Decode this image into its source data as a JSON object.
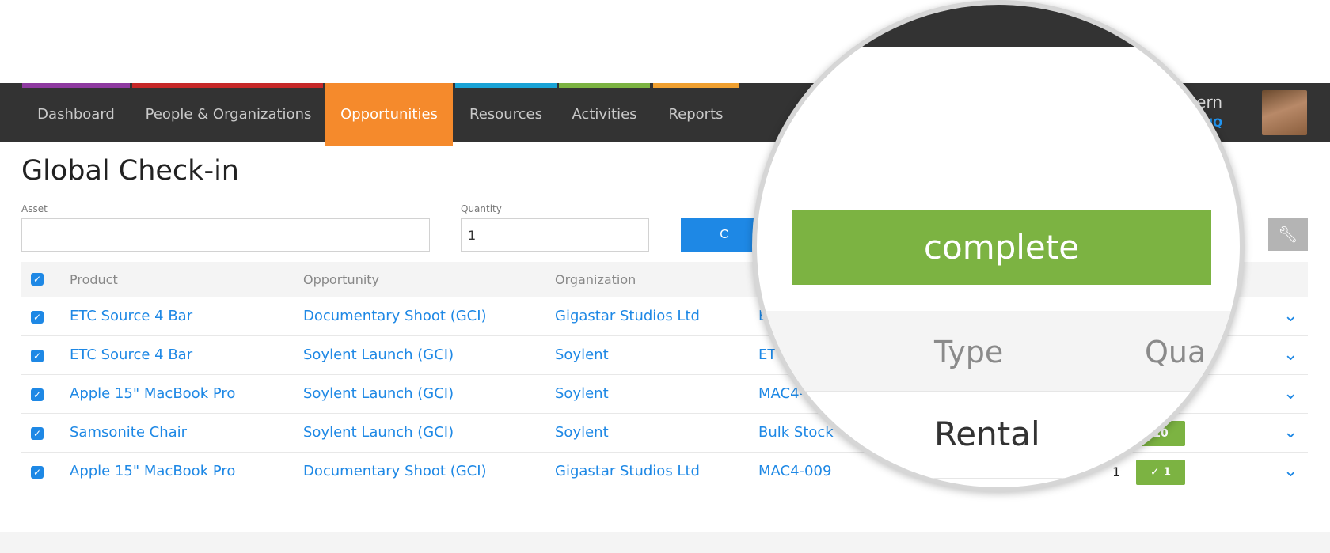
{
  "nav": {
    "items": [
      {
        "label": "Dashboard",
        "stripe": "#333333"
      },
      {
        "label": "People & Organizations",
        "stripe": "#c62828"
      },
      {
        "label": "Opportunities",
        "stripe": "#f58a2c",
        "active": true
      },
      {
        "label": "Resources",
        "stripe": "#1aa3d6"
      },
      {
        "label": "Activities",
        "stripe": "#7cb342"
      },
      {
        "label": "Reports",
        "stripe": "#f0a030"
      }
    ],
    "first_stripe": "#8e3aa0",
    "user_name": "Govern",
    "user_location": "AV: HQ"
  },
  "page": {
    "title": "Global Check-in",
    "asset_label": "Asset",
    "asset_value": "",
    "quantity_label": "Quantity",
    "quantity_value": "1",
    "checkin_button": "C",
    "settings_icon": "wrench-icon"
  },
  "table": {
    "headers": [
      "Product",
      "Opportunity",
      "Organization"
    ],
    "rows": [
      {
        "product": "ETC Source 4 Bar",
        "opportunity": "Documentary Shoot (GCI)",
        "organization": "Gigastar Studios Ltd",
        "asset": "E",
        "qty": "",
        "badge": ""
      },
      {
        "product": "ETC Source 4 Bar",
        "opportunity": "Soylent Launch (GCI)",
        "organization": "Soylent",
        "asset": "ET",
        "qty": "",
        "badge": ""
      },
      {
        "product": "Apple 15\" MacBook Pro",
        "opportunity": "Soylent Launch (GCI)",
        "organization": "Soylent",
        "asset": "MAC4-",
        "qty": "",
        "badge": ""
      },
      {
        "product": "Samsonite Chair",
        "opportunity": "Soylent Launch (GCI)",
        "organization": "Soylent",
        "asset": "Bulk Stock",
        "qty": "",
        "badge": "10"
      },
      {
        "product": "Apple 15\" MacBook Pro",
        "opportunity": "Documentary Shoot (GCI)",
        "organization": "Gigastar Studios Ltd",
        "asset": "MAC4-009",
        "qty": "1",
        "badge": "✓ 1"
      }
    ]
  },
  "magnifier": {
    "complete_label": "complete",
    "type_header": "Type",
    "qty_header": "Qua",
    "type_value": "Rental"
  },
  "colors": {
    "nav_bg": "#333333",
    "accent_orange": "#f58a2c",
    "link_blue": "#1e88e5",
    "success_green": "#7cb342"
  }
}
